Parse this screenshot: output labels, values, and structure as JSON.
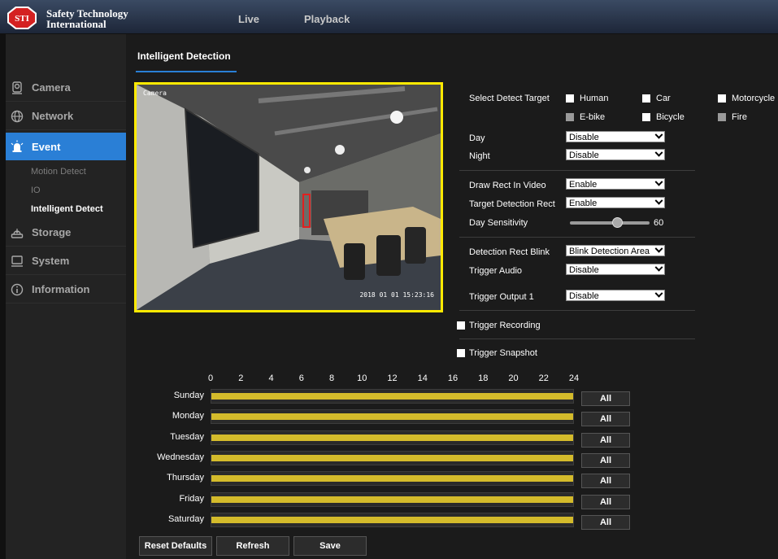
{
  "brand": {
    "badge": "STI",
    "line1": "Safety Technology",
    "line2": "International",
    "badge_color": "#d42121"
  },
  "topnav": {
    "live": "Live",
    "playback": "Playback"
  },
  "sidebar": {
    "camera": "Camera",
    "network": "Network",
    "event": "Event",
    "event_sub": {
      "motion": "Motion Detect",
      "io": "IO",
      "intelligent": "Intelligent Detect"
    },
    "storage": "Storage",
    "system": "System",
    "information": "Information"
  },
  "main": {
    "tab_title": "Intelligent Detection"
  },
  "video": {
    "osd_timestamp": "2018 01 01  15:23:16",
    "osd_label": "Camera"
  },
  "form": {
    "detect_target_label": "Select Detect Target",
    "targets": {
      "human": "Human",
      "car": "Car",
      "motorcycle": "Motorcycle",
      "ebike": "E-bike",
      "bicycle": "Bicycle",
      "fire": "Fire"
    },
    "day_label": "Day",
    "day_value": "Disable",
    "night_label": "Night",
    "night_value": "Disable",
    "draw_rect_label": "Draw Rect In Video",
    "draw_rect_value": "Enable",
    "target_rect_label": "Target Detection Rect",
    "target_rect_value": "Enable",
    "sensitivity_label": "Day Sensitivity",
    "sensitivity_value": "60",
    "rect_blink_label": "Detection Rect Blink",
    "rect_blink_value": "Blink Detection Area",
    "trigger_audio_label": "Trigger Audio",
    "trigger_audio_value": "Disable",
    "trigger_output_label": "Trigger Output 1",
    "trigger_output_value": "Disable",
    "trigger_recording_label": "Trigger Recording",
    "trigger_snapshot_label": "Trigger Snapshot"
  },
  "schedule": {
    "hours": [
      "0",
      "2",
      "4",
      "6",
      "8",
      "10",
      "12",
      "14",
      "16",
      "18",
      "20",
      "22",
      "24"
    ],
    "days": [
      "Sunday",
      "Monday",
      "Tuesday",
      "Wednesday",
      "Thursday",
      "Friday",
      "Saturday"
    ],
    "all_label": "All",
    "coverage": 1.0,
    "bar_color": "#d4bb2b"
  },
  "buttons": {
    "reset": "Reset Defaults",
    "refresh": "Refresh",
    "save": "Save"
  },
  "colors": {
    "accent": "#2a7fd6",
    "video_border": "#ffea00"
  }
}
